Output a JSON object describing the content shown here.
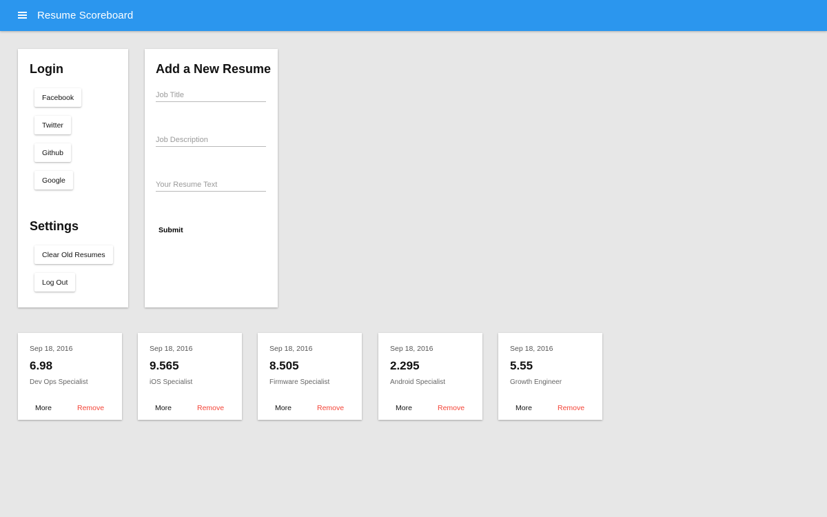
{
  "app": {
    "title": "Resume Scoreboard",
    "menu_icon": "menu-icon",
    "accent": "#2b96ee"
  },
  "login": {
    "heading": "Login",
    "buttons": [
      "Facebook",
      "Twitter",
      "Github",
      "Google"
    ]
  },
  "settings": {
    "heading": "Settings",
    "buttons": [
      "Clear Old Resumes",
      "Log Out"
    ]
  },
  "new_resume": {
    "heading": "Add a New Resume",
    "job_title_placeholder": "Job Title",
    "job_description_placeholder": "Job Description",
    "resume_text_placeholder": "Your Resume Text",
    "submit_label": "Submit"
  },
  "resumes": [
    {
      "date": "Sep 18, 2016",
      "score": "6.98",
      "title": "Dev Ops Specialist",
      "more": "More",
      "remove": "Remove"
    },
    {
      "date": "Sep 18, 2016",
      "score": "9.565",
      "title": "iOS Specialist",
      "more": "More",
      "remove": "Remove"
    },
    {
      "date": "Sep 18, 2016",
      "score": "8.505",
      "title": "Firmware Specialist",
      "more": "More",
      "remove": "Remove"
    },
    {
      "date": "Sep 18, 2016",
      "score": "2.295",
      "title": "Android Specialist",
      "more": "More",
      "remove": "Remove"
    },
    {
      "date": "Sep 18, 2016",
      "score": "5.55",
      "title": "Growth Engineer",
      "more": "More",
      "remove": "Remove"
    }
  ],
  "colors": {
    "remove": "#f44336",
    "background": "#e7e7e7"
  }
}
